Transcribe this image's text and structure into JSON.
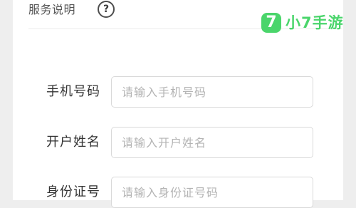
{
  "header": {
    "title": "服务说明",
    "help_icon": "?"
  },
  "logo": {
    "mark": "7",
    "text": "小7手游",
    "color": "#4ad56b"
  },
  "form": {
    "fields": [
      {
        "label": "手机号码",
        "placeholder": "请输入手机号码",
        "value": ""
      },
      {
        "label": "开户姓名",
        "placeholder": "请输入开户姓名",
        "value": ""
      },
      {
        "label": "身份证号",
        "placeholder": "请输入身份证号码",
        "value": ""
      }
    ]
  }
}
